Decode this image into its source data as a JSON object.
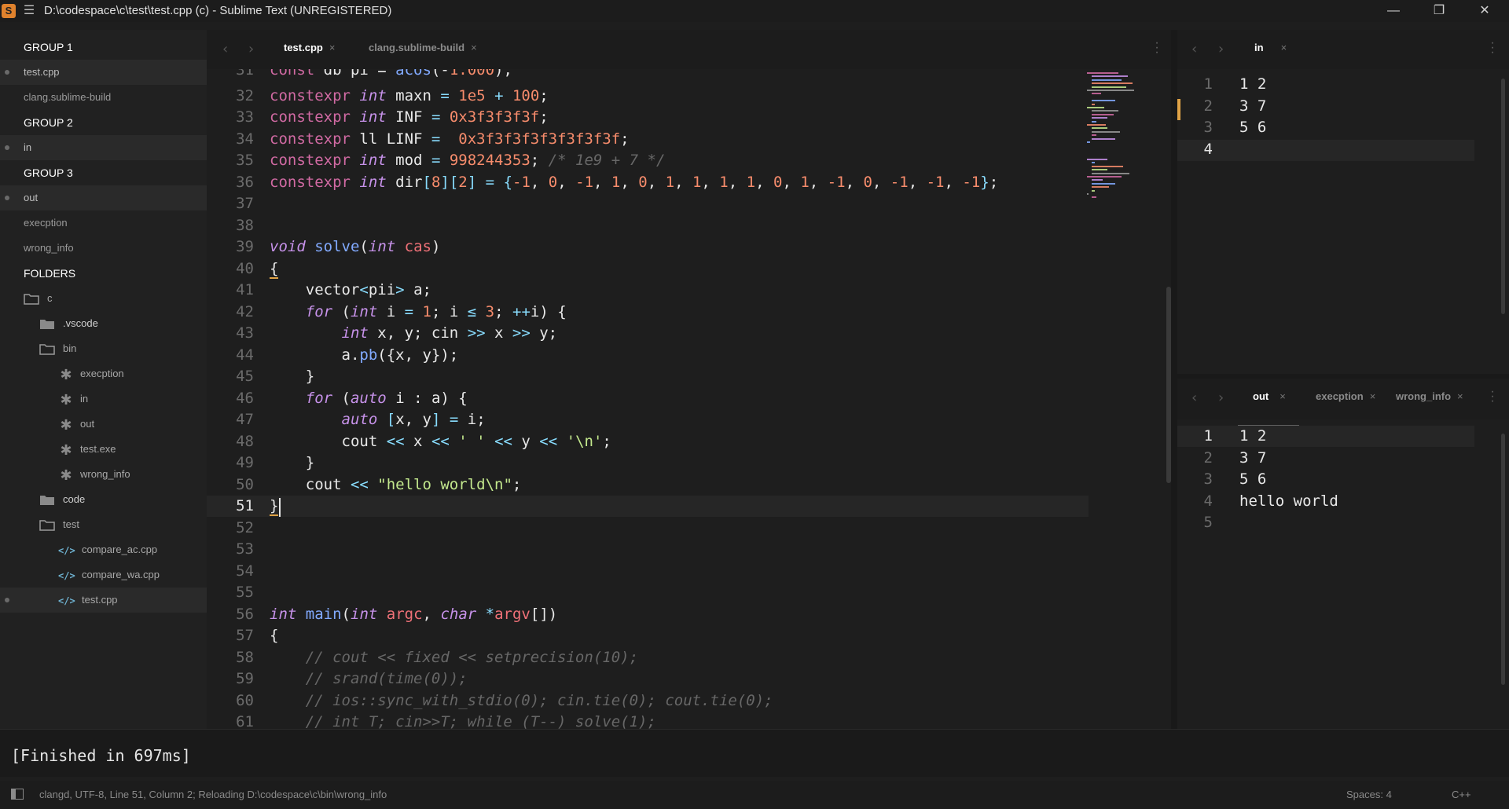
{
  "window": {
    "title": "D:\\codespace\\c\\test\\test.cpp (c) - Sublime Text (UNREGISTERED)",
    "app_icon": "S",
    "minimize": "—",
    "restore": "❐",
    "close": "✕"
  },
  "sidebar": {
    "group1": "GROUP 1",
    "group1_items": [
      "test.cpp",
      "clang.sublime-build"
    ],
    "group2": "GROUP 2",
    "group2_items": [
      "in"
    ],
    "group3": "GROUP 3",
    "group3_items": [
      "out",
      "execption",
      "wrong_info"
    ],
    "folders": "FOLDERS",
    "tree": {
      "root": "c",
      "vscode": ".vscode",
      "bin": "bin",
      "bin_files": [
        "execption",
        "in",
        "out",
        "test.exe",
        "wrong_info"
      ],
      "code": "code",
      "test": "test",
      "test_files": [
        "compare_ac.cpp",
        "compare_wa.cpp",
        "test.cpp"
      ]
    }
  },
  "editor": {
    "tabs": [
      {
        "label": "test.cpp",
        "close": "×"
      },
      {
        "label": "clang.sublime-build",
        "close": "×"
      }
    ],
    "line_numbers": [
      "31",
      "32",
      "33",
      "34",
      "35",
      "36",
      "37",
      "38",
      "39",
      "40",
      "41",
      "42",
      "43",
      "44",
      "45",
      "46",
      "47",
      "48",
      "49",
      "50",
      "51",
      "52",
      "53",
      "54",
      "55",
      "56",
      "57",
      "58",
      "59",
      "60",
      "61"
    ],
    "current_line": "51"
  },
  "pane_in": {
    "tab": "in",
    "close": "×",
    "line_numbers": [
      "1",
      "2",
      "3",
      "4"
    ],
    "lines": [
      "1 2",
      "3 7",
      "5 6",
      ""
    ]
  },
  "pane_out": {
    "tabs": [
      {
        "label": "out",
        "close": "×"
      },
      {
        "label": "execption",
        "close": "×"
      },
      {
        "label": "wrong_info",
        "close": "×"
      }
    ],
    "line_numbers": [
      "1",
      "2",
      "3",
      "4",
      "5"
    ],
    "lines": [
      "1 2",
      "3 7",
      "5 6",
      "hello world",
      ""
    ]
  },
  "output": {
    "text": "[Finished in 697ms]"
  },
  "status": {
    "text": "clangd, UTF-8, Line 51, Column 2; Reloading D:\\codespace\\c\\bin\\wrong_info",
    "spaces": "Spaces: 4",
    "syntax": "C++"
  },
  "colors": {
    "keyword": "#d16aa3",
    "type": "#c792ea",
    "number": "#f78c6c",
    "function": "#82aaff",
    "string": "#c3e88d",
    "comment": "#676767",
    "operator": "#89ddff",
    "modified_marker": "#e0a346"
  },
  "icons": [
    "app-icon",
    "hamburger-icon",
    "minimize-icon",
    "restore-icon",
    "close-icon",
    "folder-icon",
    "file-icon",
    "code-file-icon",
    "chevron-left-icon",
    "chevron-right-icon",
    "kebab-icon",
    "panel-toggle-icon"
  ]
}
